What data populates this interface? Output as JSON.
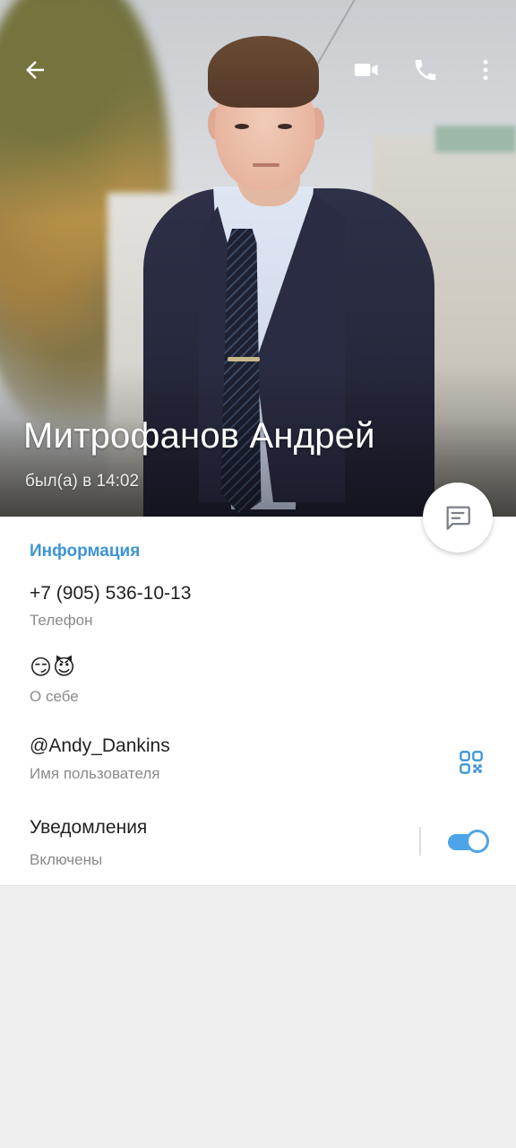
{
  "header": {
    "name": "Митрофанов Андрей",
    "last_seen": "был(а) в 14:02",
    "icons": {
      "back": "arrow-back-icon",
      "video": "video-camera-icon",
      "call": "phone-icon",
      "more": "more-vertical-icon",
      "message": "message-icon"
    }
  },
  "info": {
    "section_title": "Информация",
    "phone": {
      "value": "+7 (905) 536-10-13",
      "label": "Телефон"
    },
    "bio": {
      "value": "😏😈",
      "label": "О себе"
    },
    "username": {
      "value": "@Andy_Dankins",
      "label": "Имя пользователя",
      "icon": "qr-code-icon"
    },
    "notifications": {
      "value": "Уведомления",
      "label": "Включены",
      "enabled": true
    }
  },
  "colors": {
    "accent": "#3d95d4",
    "toggle": "#4ea4e8",
    "background": "#efefef"
  }
}
